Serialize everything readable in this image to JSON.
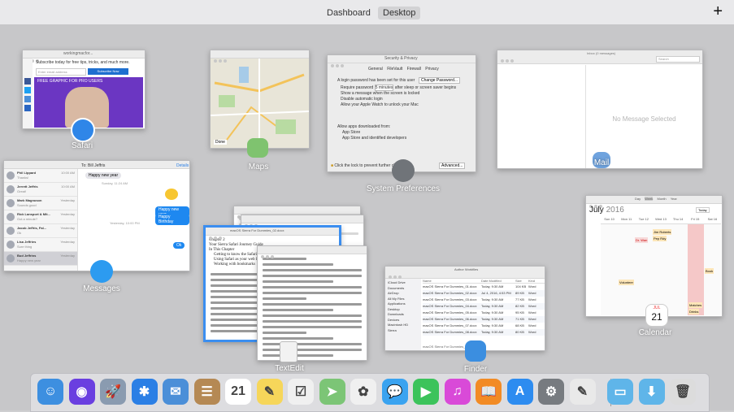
{
  "spaces_bar": {
    "tabs": [
      "Dashboard",
      "Desktop"
    ],
    "active": "Desktop",
    "add_label": "+"
  },
  "windows": {
    "safari": {
      "label": "Safari",
      "url": "workingmacfor...",
      "subscribe_text": "Subscribe today for free tips, tricks, and much more.",
      "email_placeholder": "Enter email address",
      "subscribe_button": "Subscribe Now",
      "banner": "FREE GRAPHIC FOR PRO USERS"
    },
    "maps": {
      "label": "Maps",
      "map_button": "Done"
    },
    "system_preferences": {
      "label": "System Preferences",
      "title": "Security & Privacy",
      "tabs": [
        "General",
        "FileVault",
        "Firewall",
        "Privacy"
      ],
      "password_text": "A login password has been set for this user",
      "change_password": "Change Password...",
      "options": [
        "Require password",
        "Show a message when the screen is locked",
        "Disable automatic login",
        "Allow your Apple Watch to unlock your Mac"
      ],
      "require_value": "5 minutes",
      "after_text": "after sleep or screen saver begins",
      "allow_heading": "Allow apps downloaded from:",
      "allow_options": [
        "App Store",
        "App Store and identified developers"
      ],
      "lock_text": "Click the lock to prevent further changes.",
      "advanced": "Advanced..."
    },
    "mail": {
      "label": "Mail",
      "title": "Inbox (0 messages)",
      "search_placeholder": "Search",
      "empty_text": "No Message Selected"
    },
    "messages": {
      "label": "Messages",
      "to_label": "To: Bill Jeffris",
      "details": "Details",
      "contacts": [
        {
          "name": "Phil Lippard",
          "time": "10:00 AM",
          "preview": "Thanks!"
        },
        {
          "name": "Jerrett Jeffris",
          "time": "10:00 AM",
          "preview": "Great!"
        },
        {
          "name": "Mark Magnuson",
          "time": "Yesterday",
          "preview": "Sounds good"
        },
        {
          "name": "Rick Lansport & Mit...",
          "time": "Yesterday",
          "preview": "Got a minute?"
        },
        {
          "name": "Jacob Jeffris, Fal...",
          "time": "Yesterday",
          "preview": "Ok"
        },
        {
          "name": "Lisa Jeffries",
          "time": "Yesterday",
          "preview": "Sure thing"
        },
        {
          "name": "Bud Jeffrins",
          "time": "Yesterday",
          "preview": "Happy new year"
        }
      ],
      "bubbles": [
        "Happy new year",
        "Happy new year",
        "Happy Birthday",
        "Ok"
      ],
      "timestamps": [
        "Sunday, 11:24 AM",
        "Yesterday, 10:00 PM"
      ]
    },
    "textedit": {
      "label": "TextEdit",
      "title": "macOS Sierra For Dummies_02.docx",
      "chapter": "Chapter 2",
      "subtitle": "Your Sierra Safari Journey Guide",
      "headings": [
        "In This Chapter"
      ],
      "bullets": [
        "Getting to know the Safari window",
        "Using Safari as your web browser",
        "Working with bookmarks"
      ]
    },
    "finder": {
      "label": "Finder",
      "title": "Author Workfiles",
      "sidebar": [
        "iCloud Drive",
        "Documents",
        "AirDrop",
        "All My Files",
        "Applications",
        "Desktop",
        "Downloads",
        "Devices",
        "Macintosh HD",
        "Sierra"
      ],
      "columns": [
        "Name",
        "Date Modified",
        "Size",
        "Kind"
      ],
      "rows": [
        {
          "name": "macOS Sierra For Dummies_01.docx",
          "date": "Today, 9:30 AM",
          "size": "104 KB",
          "kind": "Word"
        },
        {
          "name": "macOS Sierra For Dummies_02.docx",
          "date": "Jul 4, 2016, 4:53 PM",
          "size": "89 KB",
          "kind": "Word"
        },
        {
          "name": "macOS Sierra For Dummies_03.docx",
          "date": "Today, 9:30 AM",
          "size": "77 KB",
          "kind": "Word"
        },
        {
          "name": "macOS Sierra For Dummies_04.docx",
          "date": "Today, 9:30 AM",
          "size": "82 KB",
          "kind": "Word"
        },
        {
          "name": "macOS Sierra For Dummies_05.docx",
          "date": "Today, 9:30 AM",
          "size": "95 KB",
          "kind": "Word"
        },
        {
          "name": "macOS Sierra For Dummies_06.docx",
          "date": "Today, 9:30 AM",
          "size": "71 KB",
          "kind": "Word"
        },
        {
          "name": "macOS Sierra For Dummies_07.docx",
          "date": "Today, 9:30 AM",
          "size": "68 KB",
          "kind": "Word"
        },
        {
          "name": "macOS Sierra For Dummies_08.docx",
          "date": "Today, 9:30 AM",
          "size": "80 KB",
          "kind": "Word"
        }
      ],
      "path": "macOS Sierra For Dummies_03.docx"
    },
    "calendar": {
      "label": "Calendar",
      "month": "July",
      "year": "2016",
      "views": [
        "Day",
        "Week",
        "Month",
        "Year"
      ],
      "active_view": "Week",
      "today_button": "Today",
      "days": [
        "Sun 10",
        "Mon 11",
        "Tue 12",
        "Wed 13",
        "Thu 14",
        "Fri 15",
        "Sat 16"
      ],
      "today_day": "14",
      "events": [
        "Dr. Wan",
        "Jim Roberts",
        "Pep Rdy",
        "Volunteer",
        "Book",
        "Matches",
        "Drinks"
      ],
      "icon_month": "JUL",
      "icon_day": "21"
    }
  },
  "dock": {
    "apps": [
      {
        "name": "Finder",
        "color": "#3d8fe0",
        "glyph": "☺"
      },
      {
        "name": "Siri",
        "color": "#6a3fe0",
        "glyph": "◉"
      },
      {
        "name": "Launchpad",
        "color": "#8a9bb0",
        "glyph": "🚀"
      },
      {
        "name": "Safari",
        "color": "#2b7fe5",
        "glyph": "✱"
      },
      {
        "name": "Mail",
        "color": "#4b8fd8",
        "glyph": "✉"
      },
      {
        "name": "Contacts",
        "color": "#b58954",
        "glyph": "☰"
      },
      {
        "name": "Calendar",
        "color": "#ffffff",
        "glyph": "21"
      },
      {
        "name": "Notes",
        "color": "#f6d65a",
        "glyph": "✎"
      },
      {
        "name": "Reminders",
        "color": "#f0f0f0",
        "glyph": "☑"
      },
      {
        "name": "Maps",
        "color": "#7cc576",
        "glyph": "➤"
      },
      {
        "name": "Photos",
        "color": "#f0f0f0",
        "glyph": "✿"
      },
      {
        "name": "Messages",
        "color": "#3aa3f0",
        "glyph": "💬"
      },
      {
        "name": "FaceTime",
        "color": "#3cc35b",
        "glyph": "▶"
      },
      {
        "name": "iTunes",
        "color": "#d94ad8",
        "glyph": "♫"
      },
      {
        "name": "iBooks",
        "color": "#f28b25",
        "glyph": "📖"
      },
      {
        "name": "App Store",
        "color": "#2d8cf0",
        "glyph": "A"
      },
      {
        "name": "System Preferences",
        "color": "#777b80",
        "glyph": "⚙"
      },
      {
        "name": "TextEdit",
        "color": "#e9e9e9",
        "glyph": "✎"
      },
      {
        "name": "Applications Folder",
        "color": "#5fb5e9",
        "glyph": "▭"
      },
      {
        "name": "Downloads",
        "color": "#5fb5e9",
        "glyph": "⬇"
      },
      {
        "name": "Trash",
        "color": "#dcdcdc",
        "glyph": "🗑"
      }
    ]
  }
}
